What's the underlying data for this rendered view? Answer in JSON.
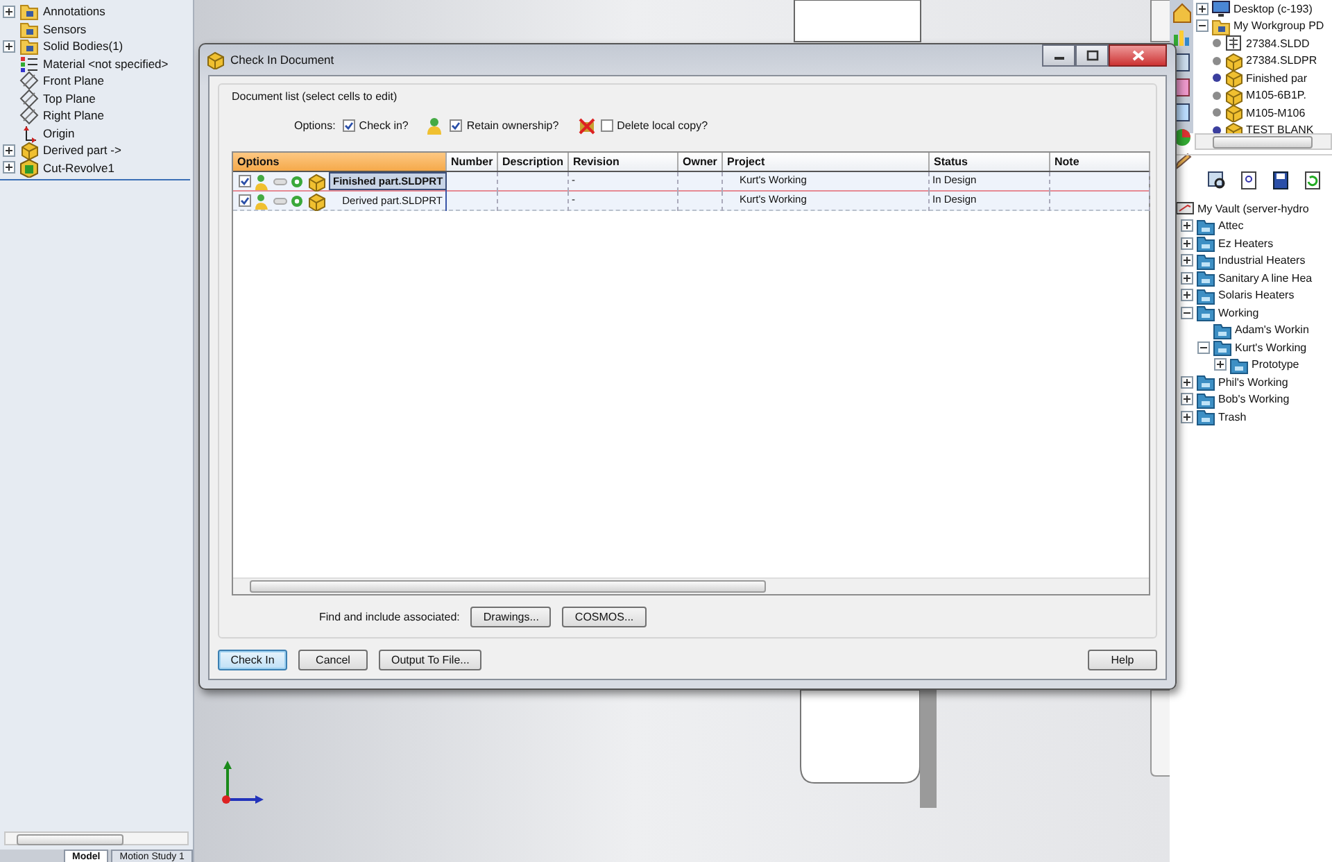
{
  "feature_tree": {
    "items": [
      {
        "label": "Annotations",
        "expandable": true
      },
      {
        "label": "Sensors",
        "expandable": false
      },
      {
        "label": "Solid Bodies(1)",
        "expandable": true
      },
      {
        "label": "Material <not specified>",
        "expandable": false
      },
      {
        "label": "Front Plane",
        "expandable": false
      },
      {
        "label": "Top Plane",
        "expandable": false
      },
      {
        "label": "Right Plane",
        "expandable": false
      },
      {
        "label": "Origin",
        "expandable": false
      },
      {
        "label": "Derived part ->",
        "expandable": true
      },
      {
        "label": "Cut-Revolve1",
        "expandable": true
      }
    ]
  },
  "bottom_tabs": [
    {
      "label": "Model",
      "selected": true
    },
    {
      "label": "Motion Study 1",
      "selected": false
    }
  ],
  "dialog": {
    "title": "Check In Document",
    "group_label": "Document list (select cells to edit)",
    "options_label": "Options:",
    "options": [
      {
        "label": "Check in?",
        "checked": true
      },
      {
        "label": "Retain ownership?",
        "checked": true
      },
      {
        "label": "Delete local copy?",
        "checked": false
      }
    ],
    "table": {
      "columns": [
        "Options",
        "Number",
        "Description",
        "Revision",
        "Owner",
        "Project",
        "Status",
        "Note"
      ],
      "rows": [
        {
          "checked": true,
          "selected": true,
          "file": "Finished part.SLDPRT",
          "revision": "-",
          "project": "Kurt's Working",
          "status": "In Design"
        },
        {
          "checked": true,
          "selected": false,
          "file": "Derived part.SLDPRT",
          "revision": "-",
          "project": "Kurt's Working",
          "status": "In Design"
        }
      ]
    },
    "find_label": "Find and include associated:",
    "find_buttons": [
      "Drawings...",
      "COSMOS..."
    ],
    "buttons": [
      {
        "label": "Check In",
        "default": true
      },
      {
        "label": "Cancel",
        "default": false
      },
      {
        "label": "Output To File...",
        "default": false
      },
      {
        "label": "Help",
        "default": false
      }
    ]
  },
  "vault_browser": {
    "workgroup_tree": [
      {
        "label": "Desktop (c-193)",
        "expanded": false
      },
      {
        "label": "My Workgroup PD",
        "expanded": true,
        "children": [
          {
            "label": "27384.SLDD",
            "color": "#8c8c8c"
          },
          {
            "label": "27384.SLDPR",
            "color": "#8c8c8c"
          },
          {
            "label": "Finished par",
            "color": "#3b3f9e"
          },
          {
            "label": "M105-6B1P.",
            "color": "#8c8c8c"
          },
          {
            "label": "M105-M106",
            "color": "#8c8c8c"
          },
          {
            "label": "TEST BLANK",
            "color": "#3b3f9e"
          }
        ]
      }
    ],
    "vault": {
      "label": "My Vault (server-hydro",
      "children": [
        {
          "label": "Attec",
          "expanded": false
        },
        {
          "label": "Ez Heaters",
          "expanded": false
        },
        {
          "label": "Industrial Heaters",
          "expanded": false
        },
        {
          "label": "Sanitary A line Hea",
          "expanded": false
        },
        {
          "label": "Solaris Heaters",
          "expanded": false
        },
        {
          "label": "Working",
          "expanded": true,
          "children": [
            {
              "label": "Adam's Workin"
            },
            {
              "label": "Kurt's Working",
              "expanded": true,
              "children": [
                {
                  "label": "Prototype",
                  "expanded": false
                }
              ]
            }
          ]
        },
        {
          "label": "Phil's Working",
          "expanded": false
        },
        {
          "label": "Bob's Working",
          "expanded": false
        },
        {
          "label": "Trash",
          "expanded": false
        }
      ]
    }
  }
}
